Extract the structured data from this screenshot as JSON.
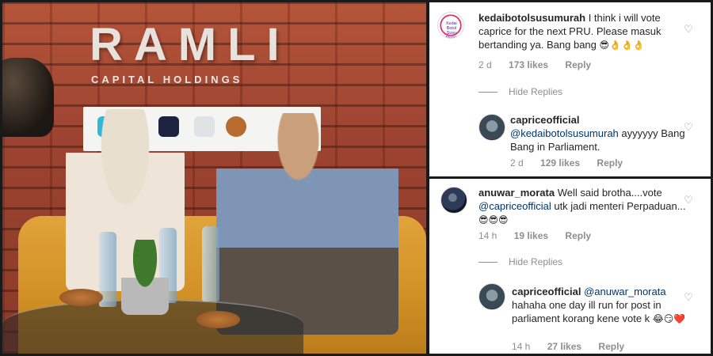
{
  "photo": {
    "brand_logo": "RAMLI",
    "brand_sub": "CAPITAL HOLDINGS"
  },
  "thread_1": {
    "comment": {
      "username": "kedaibotolsusumurah",
      "avatar_icon": "kedai-logo-avatar",
      "avatar_text": "Kedai Botol Susu Murah",
      "text": "I think i will vote caprice for the next PRU. Please masuk bertanding ya. Bang bang",
      "emoji": "😎👌👌👌",
      "time": "2 d",
      "likes": "173 likes",
      "reply": "Reply"
    },
    "hide_replies": "Hide Replies",
    "reply": {
      "username": "capriceofficial",
      "mention": "@kedaibotolsusumurah",
      "text": "ayyyyyy Bang Bang in Parliament.",
      "time": "2 d",
      "likes": "129 likes",
      "reply": "Reply"
    }
  },
  "thread_2": {
    "comment": {
      "username": "anuwar_morata",
      "text_before": "Well said brotha....vote",
      "mention": "@capriceofficial",
      "text_after": "utk jadi menteri Perpaduan...",
      "emoji": "😎😎😎",
      "time": "14 h",
      "likes": "19 likes",
      "reply": "Reply"
    },
    "hide_replies": "Hide Replies",
    "reply": {
      "username": "capriceofficial",
      "mention": "@anuwar_morata",
      "text": "hahaha one day ill run for post in parliament korang kene vote k",
      "emoji": "😂😏❤️",
      "time": "14 h",
      "likes": "27 likes",
      "reply": "Reply"
    }
  },
  "icons": {
    "like": "heart-outline-icon"
  }
}
